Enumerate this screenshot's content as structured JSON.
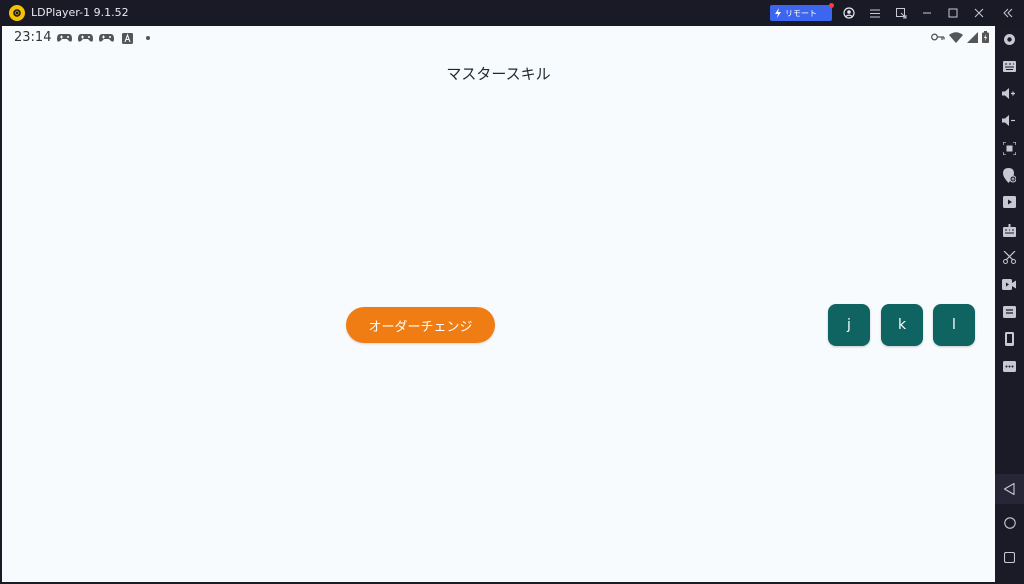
{
  "window": {
    "title": "LDPlayer-1 9.1.52",
    "remote_label": "リモート"
  },
  "statusbar": {
    "time": "23:14",
    "notif_icons": [
      "gamepad-icon",
      "gamepad-icon",
      "gamepad-icon",
      "app-a-icon",
      "dot-icon"
    ],
    "system_icons": [
      "key-icon",
      "wifi-icon",
      "signal-icon",
      "battery-icon"
    ]
  },
  "main": {
    "title": "マスタースキル",
    "order_change_label": "オーダーチェンジ",
    "keys": [
      "j",
      "k",
      "l"
    ]
  },
  "sidebar": {
    "tools": [
      "settings-icon",
      "keyboard-map-icon",
      "volume-up-icon",
      "volume-down-icon",
      "screenshot-icon",
      "location-add-icon",
      "apk-install-icon",
      "keymap-icon",
      "scissors-icon",
      "record-icon",
      "operation-record-icon",
      "phone-rotate-icon",
      "more-icon"
    ],
    "nav": [
      "back-icon",
      "home-icon",
      "recents-icon"
    ]
  },
  "colors": {
    "accent_orange": "#f07d14",
    "key_teal": "#0f6461",
    "remote_blue": "#3d66f0"
  }
}
